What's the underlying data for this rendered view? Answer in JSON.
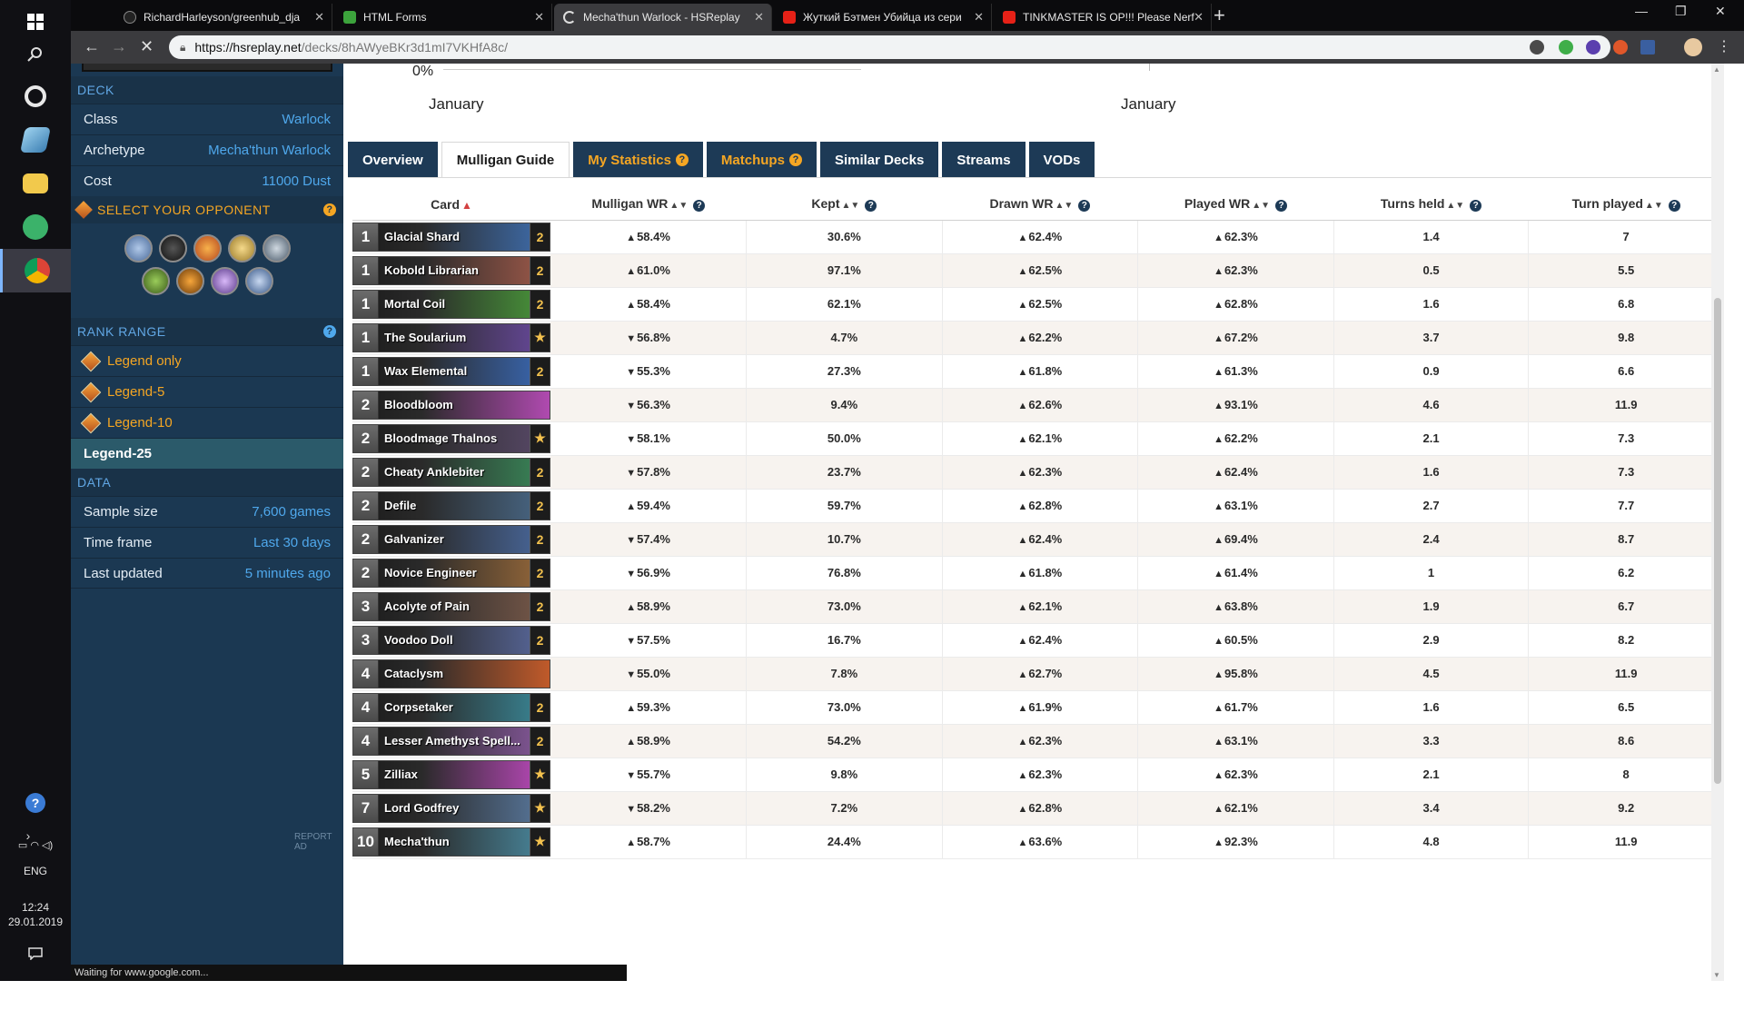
{
  "browser": {
    "tabs": [
      {
        "title": "RichardHarleyson/greenhub_dja",
        "fav_color": "#222222"
      },
      {
        "title": "HTML Forms",
        "fav_color": "#3ca33c"
      },
      {
        "title": "Mecha'thun Warlock - HSReplay",
        "fav_color": "#ffffff"
      },
      {
        "title": "Жуткий Бэтмен Убийца из сери",
        "fav_color": "#e62117"
      },
      {
        "title": "TINKMASTER IS OP!!! Please Nerf",
        "fav_color": "#e62117"
      }
    ],
    "new_tab": "+",
    "win_min": "—",
    "win_restore": "❐",
    "win_close": "✕",
    "url_host": "https://hsreplay.net",
    "url_path": "/decks/8hAWyeBKr3d1mI7VKHfA8c/"
  },
  "taskbar": {
    "lang": "ENG",
    "time": "12:24",
    "date": "29.01.2019"
  },
  "sidebar": {
    "deck_header": "DECK",
    "rows": [
      {
        "k": "Class",
        "v": "Warlock"
      },
      {
        "k": "Archetype",
        "v": "Mecha'thun Warlock"
      },
      {
        "k": "Cost",
        "v": "11000 Dust"
      }
    ],
    "opponent_header": "SELECT YOUR OPPONENT",
    "rank_header": "RANK RANGE",
    "ranks": [
      "Legend only",
      "Legend-5",
      "Legend-10",
      "Legend-25"
    ],
    "data_header": "DATA",
    "data_rows": [
      {
        "k": "Sample size",
        "v": "7,600 games"
      },
      {
        "k": "Time frame",
        "v": "Last 30 days"
      },
      {
        "k": "Last updated",
        "v": "5 minutes ago"
      }
    ],
    "report_ad": "REPORT AD",
    "help": "?"
  },
  "chart_fragment": {
    "pct": "0%",
    "month1": "January",
    "month2": "January"
  },
  "tabs": [
    {
      "label": "Overview",
      "style": "normal",
      "help": false
    },
    {
      "label": "Mulligan Guide",
      "style": "active",
      "help": false
    },
    {
      "label": "My Statistics",
      "style": "orange",
      "help": true
    },
    {
      "label": "Matchups",
      "style": "orange",
      "help": true
    },
    {
      "label": "Similar Decks",
      "style": "normal",
      "help": false
    },
    {
      "label": "Streams",
      "style": "normal",
      "help": false
    },
    {
      "label": "VODs",
      "style": "normal",
      "help": false
    }
  ],
  "columns": [
    "Card",
    "Mulligan WR",
    "Kept",
    "Drawn WR",
    "Played WR",
    "Turns held",
    "Turn played"
  ],
  "rows": [
    {
      "cost": "1",
      "name": "Glacial Shard",
      "count": "2",
      "color": "#3f6fb0",
      "mwr": "58.4%",
      "mdir": "up",
      "kept": "30.6%",
      "dwr": "62.4%",
      "pwr": "62.3%",
      "held": "1.4",
      "turn": "7"
    },
    {
      "cost": "1",
      "name": "Kobold Librarian",
      "count": "2",
      "color": "#a05a4a",
      "mwr": "61.0%",
      "mdir": "up",
      "kept": "97.1%",
      "dwr": "62.5%",
      "pwr": "62.3%",
      "held": "0.5",
      "turn": "5.5"
    },
    {
      "cost": "1",
      "name": "Mortal Coil",
      "count": "2",
      "color": "#4a9a3a",
      "mwr": "58.4%",
      "mdir": "up",
      "kept": "62.1%",
      "dwr": "62.5%",
      "pwr": "62.8%",
      "held": "1.6",
      "turn": "6.8"
    },
    {
      "cost": "1",
      "name": "The Soularium",
      "count": "★",
      "color": "#6a4aa0",
      "mwr": "56.8%",
      "mdir": "down",
      "kept": "4.7%",
      "dwr": "62.2%",
      "pwr": "67.2%",
      "held": "3.7",
      "turn": "9.8"
    },
    {
      "cost": "1",
      "name": "Wax Elemental",
      "count": "2",
      "color": "#3a6ab8",
      "mwr": "55.3%",
      "mdir": "down",
      "kept": "27.3%",
      "dwr": "61.8%",
      "pwr": "61.3%",
      "held": "0.9",
      "turn": "6.6"
    },
    {
      "cost": "2",
      "name": "Bloodbloom",
      "count": "",
      "color": "#b04ab0",
      "mwr": "56.3%",
      "mdir": "down",
      "kept": "9.4%",
      "dwr": "62.6%",
      "pwr": "93.1%",
      "held": "4.6",
      "turn": "11.9"
    },
    {
      "cost": "2",
      "name": "Bloodmage Thalnos",
      "count": "★",
      "color": "#5a4a6a",
      "mwr": "58.1%",
      "mdir": "down",
      "kept": "50.0%",
      "dwr": "62.1%",
      "pwr": "62.2%",
      "held": "2.1",
      "turn": "7.3"
    },
    {
      "cost": "2",
      "name": "Cheaty Anklebiter",
      "count": "2",
      "color": "#3a8a5a",
      "mwr": "57.8%",
      "mdir": "down",
      "kept": "23.7%",
      "dwr": "62.3%",
      "pwr": "62.4%",
      "held": "1.6",
      "turn": "7.3"
    },
    {
      "cost": "2",
      "name": "Defile",
      "count": "2",
      "color": "#4a6a8a",
      "mwr": "59.4%",
      "mdir": "up",
      "kept": "59.7%",
      "dwr": "62.8%",
      "pwr": "63.1%",
      "held": "2.7",
      "turn": "7.7"
    },
    {
      "cost": "2",
      "name": "Galvanizer",
      "count": "2",
      "color": "#4a6aa0",
      "mwr": "57.4%",
      "mdir": "down",
      "kept": "10.7%",
      "dwr": "62.4%",
      "pwr": "69.4%",
      "held": "2.4",
      "turn": "8.7"
    },
    {
      "cost": "2",
      "name": "Novice Engineer",
      "count": "2",
      "color": "#9a6a3a",
      "mwr": "56.9%",
      "mdir": "down",
      "kept": "76.8%",
      "dwr": "61.8%",
      "pwr": "61.4%",
      "held": "1",
      "turn": "6.2"
    },
    {
      "cost": "3",
      "name": "Acolyte of Pain",
      "count": "2",
      "color": "#7a5a4a",
      "mwr": "58.9%",
      "mdir": "up",
      "kept": "73.0%",
      "dwr": "62.1%",
      "pwr": "63.8%",
      "held": "1.9",
      "turn": "6.7"
    },
    {
      "cost": "3",
      "name": "Voodoo Doll",
      "count": "2",
      "color": "#5a6aa0",
      "mwr": "57.5%",
      "mdir": "down",
      "kept": "16.7%",
      "dwr": "62.4%",
      "pwr": "60.5%",
      "held": "2.9",
      "turn": "8.2"
    },
    {
      "cost": "4",
      "name": "Cataclysm",
      "count": "",
      "color": "#c05a2a",
      "mwr": "55.0%",
      "mdir": "down",
      "kept": "7.8%",
      "dwr": "62.7%",
      "pwr": "95.8%",
      "held": "4.5",
      "turn": "11.9"
    },
    {
      "cost": "4",
      "name": "Corpsetaker",
      "count": "2",
      "color": "#3a8a9a",
      "mwr": "59.3%",
      "mdir": "up",
      "kept": "73.0%",
      "dwr": "61.9%",
      "pwr": "61.7%",
      "held": "1.6",
      "turn": "6.5"
    },
    {
      "cost": "4",
      "name": "Lesser Amethyst Spell...",
      "count": "2",
      "color": "#8a5aa0",
      "mwr": "58.9%",
      "mdir": "up",
      "kept": "54.2%",
      "dwr": "62.3%",
      "pwr": "63.1%",
      "held": "3.3",
      "turn": "8.6"
    },
    {
      "cost": "5",
      "name": "Zilliax",
      "count": "★",
      "color": "#c04ac0",
      "mwr": "55.7%",
      "mdir": "down",
      "kept": "9.8%",
      "dwr": "62.3%",
      "pwr": "62.3%",
      "held": "2.1",
      "turn": "8"
    },
    {
      "cost": "7",
      "name": "Lord Godfrey",
      "count": "★",
      "color": "#5a7aa0",
      "mwr": "58.2%",
      "mdir": "down",
      "kept": "7.2%",
      "dwr": "62.8%",
      "pwr": "62.1%",
      "held": "3.4",
      "turn": "9.2"
    },
    {
      "cost": "10",
      "name": "Mecha'thun",
      "count": "★",
      "color": "#4a8aa0",
      "mwr": "58.7%",
      "mdir": "up",
      "kept": "24.4%",
      "dwr": "63.6%",
      "pwr": "92.3%",
      "held": "4.8",
      "turn": "11.9"
    }
  ],
  "status_text": "Waiting for www.google.com...",
  "glyphs": {
    "up": "▲",
    "down": "▼",
    "sort": "▲▼",
    "sort_active": "▲",
    "help": "?"
  },
  "colors": {
    "accent": "#4fa8ec",
    "nav": "#1d3a56",
    "orange": "#f5a623",
    "positive": "#2d8a2d",
    "negative": "#e08a1e"
  }
}
